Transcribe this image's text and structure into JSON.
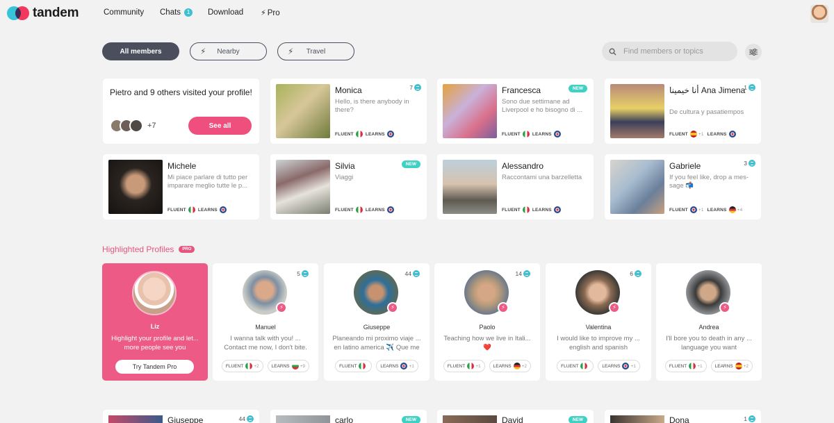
{
  "nav": {
    "brand": "tandem",
    "community": "Community",
    "chats": "Chats",
    "chats_badge": "1",
    "download": "Download",
    "pro": "Pro"
  },
  "filters": {
    "all_members": "All members",
    "nearby": "Nearby",
    "travel": "Travel",
    "search_placeholder": "Find members or topics"
  },
  "visitors": {
    "text": "Pietro and 9 others visited your profile!",
    "count": "+7",
    "button": "See all"
  },
  "labels": {
    "fluent": "FLUENT",
    "learns": "LEARNS"
  },
  "members": [
    {
      "name": "Monica",
      "bio": "Hello, is there anybody in there?",
      "count": "7",
      "new": "",
      "fluent_plus": "",
      "learns_plus": ""
    },
    {
      "name": "Francesca",
      "bio": "Sono due settimane ad Liverpool e ho bisogno di ...",
      "count": "",
      "new": "NEW",
      "fluent_plus": "",
      "learns_plus": ""
    },
    {
      "name": "أنا خيمينا Ana Jimena",
      "bio": "De cultura y pasatiempos",
      "count": "1",
      "new": "",
      "fluent_plus": "+1",
      "learns_plus": ""
    },
    {
      "name": "Michele",
      "bio": "Mi piace parlare di tutto per imparare meglio tutte le p...",
      "count": "",
      "new": "",
      "fluent_plus": "",
      "learns_plus": ""
    },
    {
      "name": "Silvia",
      "bio": "Viaggi",
      "count": "",
      "new": "NEW",
      "fluent_plus": "",
      "learns_plus": ""
    },
    {
      "name": "Alessandro",
      "bio": "Raccontami una barzelletta",
      "count": "",
      "new": "",
      "fluent_plus": "",
      "learns_plus": ""
    },
    {
      "name": "Gabriele",
      "bio": "If you feel like, drop a mes-sage 📬",
      "count": "3",
      "new": "",
      "fluent_plus": "+1",
      "learns_plus": "+4"
    }
  ],
  "highlighted": {
    "title": "Highlighted Profiles",
    "pro_tag": "PRO",
    "promo": {
      "name": "Liz",
      "text": "Highlight your profile and let... more people see you",
      "button": "Try Tandem Pro"
    },
    "profiles": [
      {
        "name": "Manuel",
        "bio": "I wanna talk with you! ... Contact me now, I don't bite.",
        "count": "5",
        "fluent_plus": "+2",
        "learns_plus": "+9"
      },
      {
        "name": "Giuseppe",
        "bio": "Planeando mi proximo viaje ... en latino america ✈️ Que me",
        "count": "44",
        "fluent_plus": "",
        "learns_plus": "+1"
      },
      {
        "name": "Paolo",
        "bio": "Teaching how we live in Itali... ❤️",
        "count": "14",
        "fluent_plus": "+1",
        "learns_plus": "+2"
      },
      {
        "name": "Valentina",
        "bio": "I would like to improve my ... english and spanish",
        "count": "6",
        "fluent_plus": "",
        "learns_plus": "+1"
      },
      {
        "name": "Andrea",
        "bio": "I'll bore you to death in any ... language you want",
        "count": "",
        "fluent_plus": "+1",
        "learns_plus": "+2"
      }
    ]
  },
  "bottom_row": [
    {
      "name": "Giuseppe",
      "count": "44",
      "new": ""
    },
    {
      "name": "carlo",
      "count": "",
      "new": "NEW"
    },
    {
      "name": "David",
      "count": "",
      "new": "NEW"
    },
    {
      "name": "Dona",
      "count": "1",
      "new": ""
    }
  ],
  "colors": {
    "accent_pink": "#ee5a86",
    "accent_teal": "#3fbfd0",
    "pill_dark": "#4b4f5d"
  }
}
